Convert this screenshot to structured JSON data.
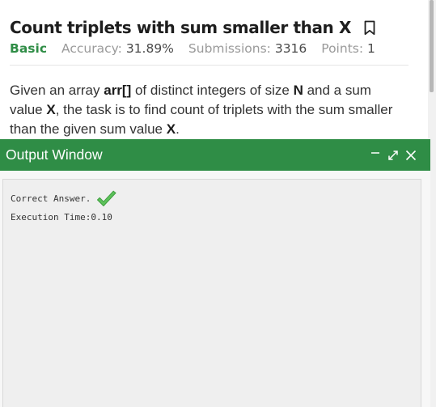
{
  "problem": {
    "title": "Count triplets with sum smaller than X",
    "difficulty": "Basic",
    "accuracy_label": "Accuracy:",
    "accuracy_value": "31.89%",
    "submissions_label": "Submissions:",
    "submissions_value": "3316",
    "points_label": "Points:",
    "points_value": "1",
    "bookmark_icon": "bookmark-icon"
  },
  "description": {
    "t1": "Given an array ",
    "b1": "arr[]",
    "t2": " of distinct integers of size ",
    "b2": "N",
    "t3": " and a sum value ",
    "b3": "X",
    "t4": ", the task is to find count of triplets with the sum smaller than the given sum value ",
    "b4": "X",
    "t5": "."
  },
  "output_window": {
    "title": "Output Window",
    "controls": [
      "minimize-icon",
      "expand-icon",
      "close-icon"
    ],
    "result_text": "Correct Answer.",
    "result_icon": "checkmark-icon",
    "execution_time": "Execution Time:0.10"
  },
  "colors": {
    "accent_green": "#2f8d46",
    "check_green": "#5cc15a"
  }
}
